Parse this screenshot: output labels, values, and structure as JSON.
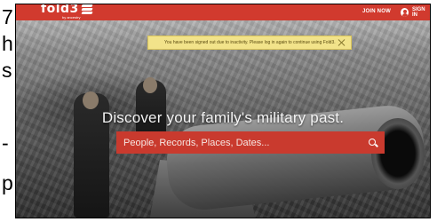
{
  "left_edge": [
    "7",
    "h",
    "s",
    "-",
    "p"
  ],
  "header": {
    "logo_text": "fold3",
    "logo_sub": "by ancestry",
    "join_label": "JOIN NOW",
    "signin_label": "SIGN IN"
  },
  "notice": {
    "message": "You have been signed out due to inactivity. Please log in again to continue using Fold3."
  },
  "hero": {
    "headline": "Discover your family's military past."
  },
  "search": {
    "placeholder": "People, Records, Places, Dates..."
  },
  "colors": {
    "brand_red": "#d13a2e",
    "notice_bg": "#f2e38a"
  }
}
